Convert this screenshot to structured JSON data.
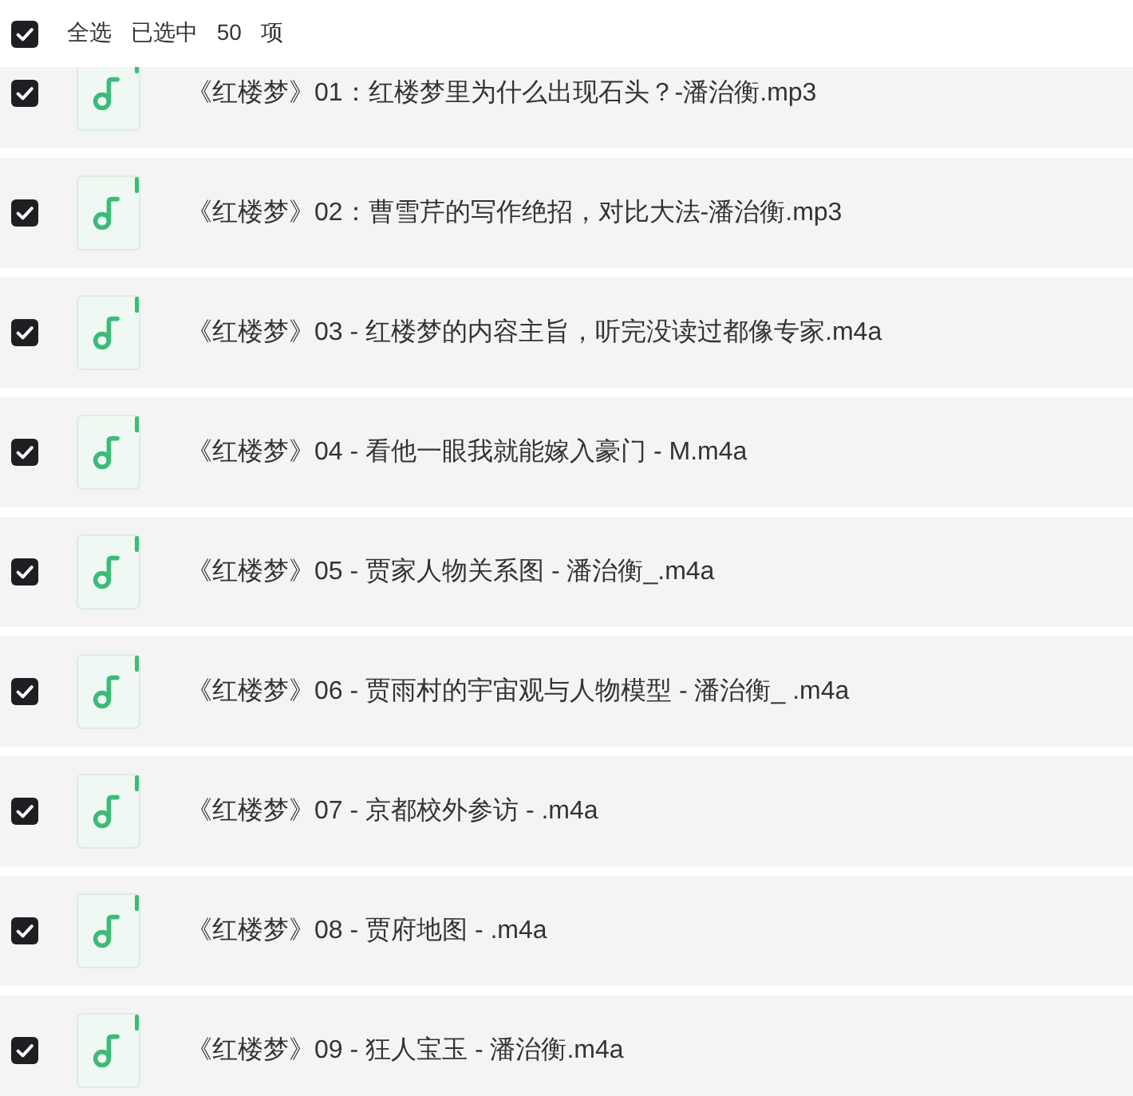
{
  "header": {
    "select_all": {
      "label": "全选",
      "checked": true
    },
    "selection_summary": "已选中 50 项"
  },
  "files": [
    {
      "name": "《红楼梦》01：红楼梦里为什么出现石头？-潘治衡.mp3",
      "checked": true
    },
    {
      "name": "《红楼梦》02：曹雪芹的写作绝招，对比大法-潘治衡.mp3",
      "checked": true
    },
    {
      "name": "《红楼梦》03 - 红楼梦的内容主旨，听完没读过都像专家.m4a",
      "checked": true
    },
    {
      "name": "《红楼梦》04 - 看他一眼我就能嫁入豪门 - M.m4a",
      "checked": true
    },
    {
      "name": "《红楼梦》05 - 贾家人物关系图 - 潘治衡_.m4a",
      "checked": true
    },
    {
      "name": "《红楼梦》06 - 贾雨村的宇宙观与人物模型 - 潘治衡_ .m4a",
      "checked": true
    },
    {
      "name": "《红楼梦》07 - 京都校外参访 - .m4a",
      "checked": true
    },
    {
      "name": "《红楼梦》08 - 贾府地图 - .m4a",
      "checked": true
    },
    {
      "name": "《红楼梦》09 - 狂人宝玉 - 潘治衡.m4a",
      "checked": true
    }
  ]
}
